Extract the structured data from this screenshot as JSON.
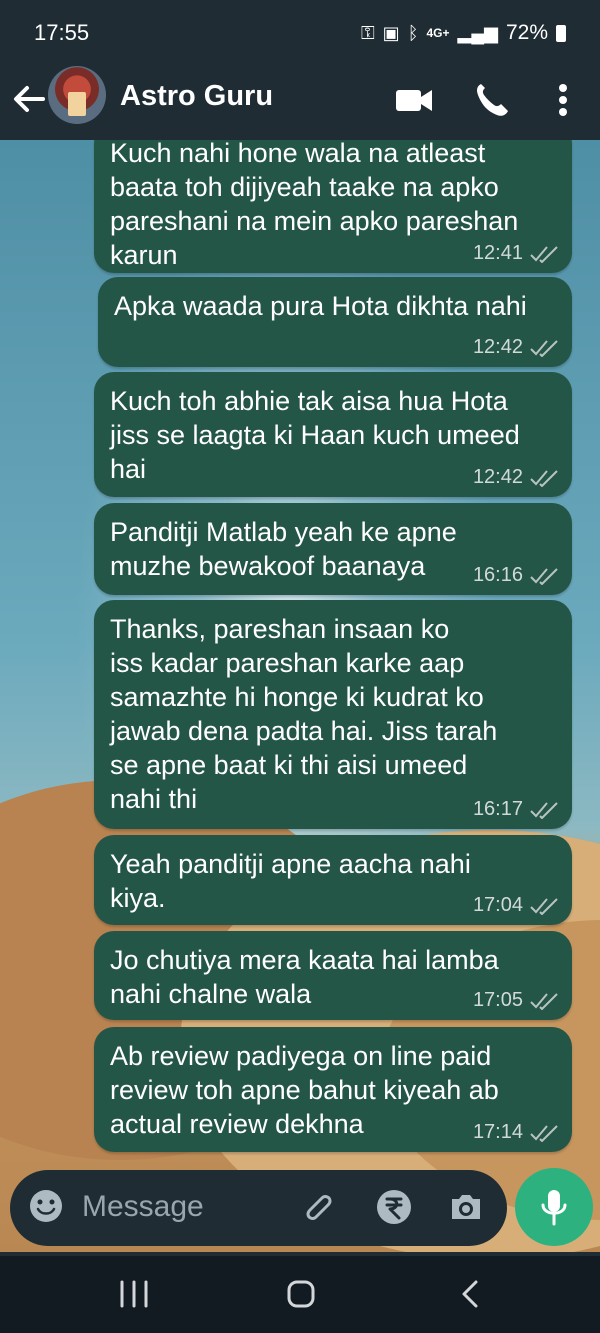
{
  "status_bar": {
    "time": "17:55",
    "network": "4G+",
    "battery": "72%"
  },
  "header": {
    "contact_name": "Astro Guru",
    "icons": [
      "back-arrow-icon",
      "video-call-icon",
      "phone-call-icon",
      "more-options-icon"
    ]
  },
  "messages": [
    {
      "text": "Kuch nahi hone wala na atleast\nbaata toh dijiyeah taake na apko\npareshani na mein apko pareshan\nkarun",
      "time": "12:41",
      "status": "read"
    },
    {
      "text": "Apka waada pura Hota dikhta nahi",
      "time": "12:42",
      "status": "read"
    },
    {
      "text": "Kuch toh abhie tak aisa hua Hota\njiss se laagta ki Haan kuch umeed\nhai",
      "time": "12:42",
      "status": "read"
    },
    {
      "text": "Panditji Matlab yeah ke apne\nmuzhe bewakoof baanaya",
      "time": "16:16",
      "status": "read"
    },
    {
      "text": "Thanks, pareshan insaan ko\niss kadar pareshan karke aap\nsamazhte hi honge ki kudrat ko\njawab dena padta hai. Jiss tarah\nse apne baat ki thi aisi umeed\nnahi thi",
      "time": "16:17",
      "status": "read"
    },
    {
      "text": "Yeah panditji apne aacha nahi\nkiya.",
      "time": "17:04",
      "status": "read"
    },
    {
      "text": "Jo chutiya mera kaata hai lamba\nnahi chalne wala",
      "time": "17:05",
      "status": "read"
    },
    {
      "text": "Ab review padiyega on line paid\nreview toh apne bahut kiyeah ab\nactual review dekhna",
      "time": "17:14",
      "status": "read"
    }
  ],
  "composer": {
    "placeholder": "Message",
    "icons": [
      "emoji-icon",
      "attachment-icon",
      "rupee-payment-icon",
      "camera-icon",
      "microphone-icon"
    ]
  },
  "nav_bar": {
    "icons": [
      "recent-apps-icon",
      "home-icon",
      "back-icon"
    ]
  },
  "colors": {
    "app_bar": "#1f2c34",
    "outgoing_bubble": "#245647",
    "accent": "#2db17e"
  }
}
